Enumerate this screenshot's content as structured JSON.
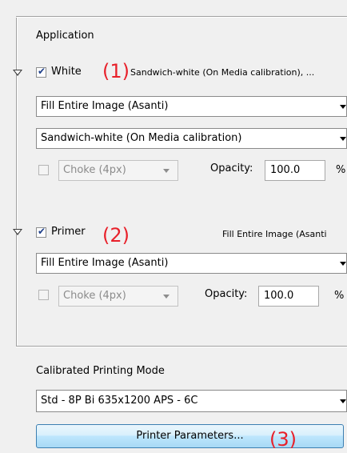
{
  "application": {
    "label": "Application",
    "white": {
      "label": "White",
      "checked": true,
      "summary": "Sandwich-white (On Media calibration), ...",
      "annotation": "(1)",
      "fill_select": "Fill Entire Image (Asanti)",
      "calibration_select": "Sandwich-white (On Media calibration)",
      "choke_select": "Choke (4px)",
      "opacity_label": "Opacity:",
      "opacity_value": "100.0",
      "percent": "%"
    },
    "primer": {
      "label": "Primer",
      "checked": true,
      "summary": "Fill Entire Image (Asanti",
      "annotation": "(2)",
      "fill_select": "Fill Entire Image (Asanti)",
      "choke_select": "Choke (4px)",
      "opacity_label": "Opacity:",
      "opacity_value": "100.0",
      "percent": "%"
    }
  },
  "printing_mode": {
    "label": "Calibrated Printing Mode",
    "select_value": "Std - 8P Bi 635x1200 APS - 6C",
    "button_label": "Printer Parameters...",
    "annotation": "(3)"
  }
}
